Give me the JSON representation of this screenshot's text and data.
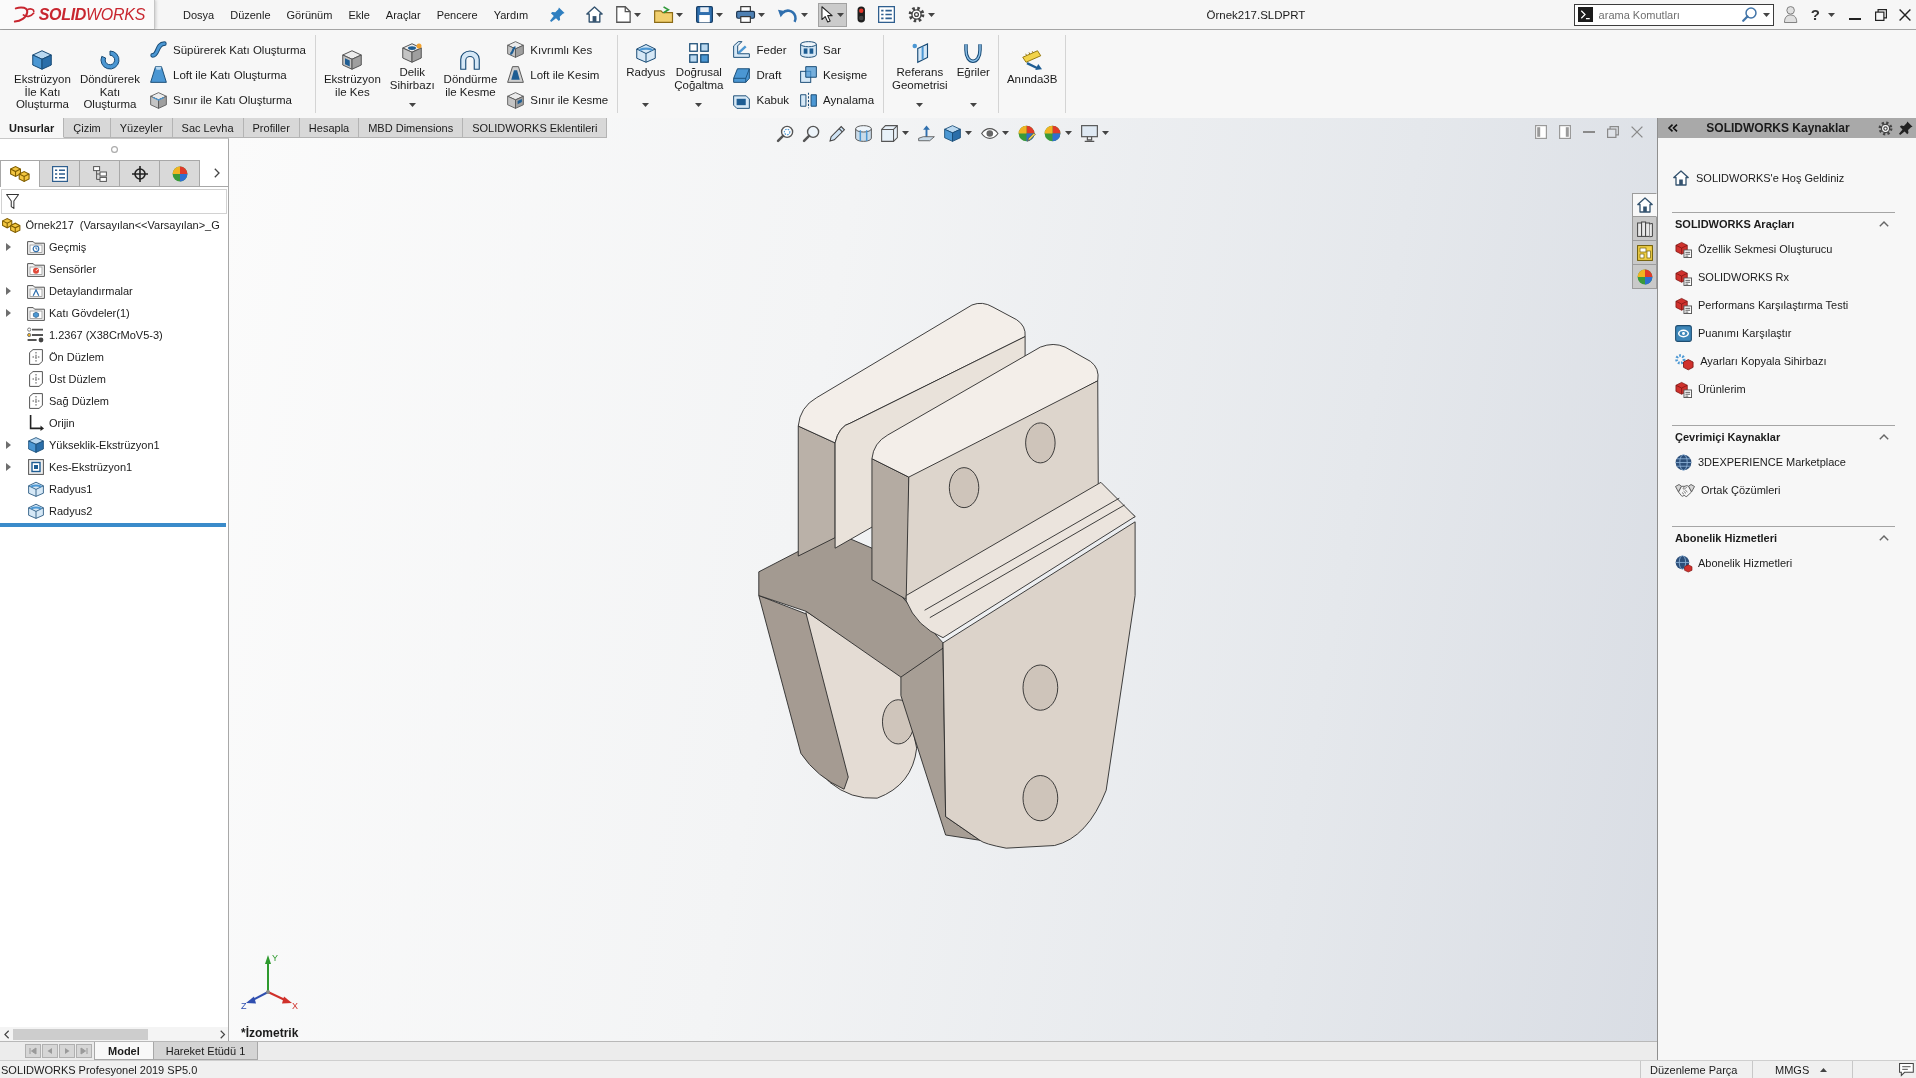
{
  "window": {
    "title": "Örnek217.SLDPRT",
    "help": "?"
  },
  "logo": {
    "text": "**SOLID**WORKS"
  },
  "menu": [
    "Dosya",
    "Düzenle",
    "Görünüm",
    "Ekle",
    "Araçlar",
    "Pencere",
    "Yardım"
  ],
  "quick_access": [
    {
      "dropdown": false,
      "selected": false
    },
    {
      "dropdown": true,
      "selected": false
    },
    {
      "dropdown": true,
      "selected": false
    },
    {
      "dropdown": true,
      "selected": false
    },
    {
      "dropdown": true,
      "selected": false
    },
    {
      "dropdown": true,
      "selected": false
    },
    {
      "dropdown": true,
      "selected": true
    },
    {
      "dropdown": false,
      "selected": false
    },
    {
      "dropdown": false,
      "selected": false
    },
    {
      "dropdown": true,
      "selected": false
    }
  ],
  "search": {
    "placeholder": "arama Komutları"
  },
  "ribbon": {
    "groups": [
      {
        "items": [
          {
            "kind": "large",
            "label": "Ekstrüzyon\nİle Katı\nOluşturma",
            "dropdown": false
          },
          {
            "kind": "large",
            "label": "Döndürerek\nKatı\nOluşturma",
            "dropdown": false
          },
          {
            "kind": "stack",
            "items": [
              "Süpürerek Katı Oluşturma",
              "Loft ile Katı Oluşturma",
              "Sınır ile Katı Oluşturma"
            ]
          }
        ]
      },
      {
        "items": [
          {
            "kind": "large",
            "label": "Ekstrüzyon\nile Kes",
            "dropdown": false
          },
          {
            "kind": "large",
            "label": "Delik\nSihirbazı",
            "dropdown": true
          },
          {
            "kind": "large",
            "label": "Döndürme\nile Kesme",
            "dropdown": false
          },
          {
            "kind": "stack",
            "items": [
              "Kıvrımlı Kes",
              "Loft ile Kesim",
              "Sınır ile Kesme"
            ]
          }
        ]
      },
      {
        "items": [
          {
            "kind": "large",
            "label": "Radyus",
            "dropdown": true
          },
          {
            "kind": "large",
            "label": "Doğrusal\nÇoğaltma",
            "dropdown": true
          },
          {
            "kind": "stack",
            "items": [
              "Feder",
              "Draft",
              "Kabuk"
            ]
          },
          {
            "kind": "stack",
            "items": [
              "Sar",
              "Kesişme",
              "Aynalama"
            ]
          }
        ]
      },
      {
        "items": [
          {
            "kind": "large",
            "label": "Referans\nGeometrisi",
            "dropdown": true
          },
          {
            "kind": "large",
            "label": "Eğriler",
            "dropdown": true
          }
        ]
      },
      {
        "items": [
          {
            "kind": "large",
            "label": "Anında3B",
            "dropdown": false
          }
        ]
      }
    ]
  },
  "command_tabs": [
    {
      "label": "Unsurlar",
      "selected": true
    },
    {
      "label": "Çizim",
      "selected": false
    },
    {
      "label": "Yüzeyler",
      "selected": false
    },
    {
      "label": "Sac Levha",
      "selected": false
    },
    {
      "label": "Profiller",
      "selected": false
    },
    {
      "label": "Hesapla",
      "selected": false
    },
    {
      "label": "MBD Dimensions",
      "selected": false
    },
    {
      "label": "SOLIDWORKS Eklentileri",
      "selected": false
    }
  ],
  "feature_manager": {
    "tabs": [
      {
        "selected": true
      },
      {
        "selected": false
      },
      {
        "selected": false
      },
      {
        "selected": false
      },
      {
        "selected": false
      }
    ],
    "tree": {
      "label": "Örnek217  (Varsayılan<<Varsayılan>_G",
      "children": [
        {
          "label": "Geçmiş",
          "kind": "history",
          "expandable": true
        },
        {
          "label": "Sensörler",
          "kind": "sensors",
          "expandable": false
        },
        {
          "label": "Detaylandırmalar",
          "kind": "annotations",
          "expandable": true
        },
        {
          "label": "Katı Gövdeler(1)",
          "kind": "bodies",
          "expandable": true
        },
        {
          "label": "1.2367 (X38CrMoV5-3)",
          "kind": "material",
          "expandable": false
        },
        {
          "label": "Ön Düzlem",
          "kind": "plane",
          "expandable": false
        },
        {
          "label": "Üst Düzlem",
          "kind": "plane",
          "expandable": false
        },
        {
          "label": "Sağ Düzlem",
          "kind": "plane",
          "expandable": false
        },
        {
          "label": "Orijin",
          "kind": "origin",
          "expandable": false
        },
        {
          "label": "Yükseklik-Ekstrüzyon1",
          "kind": "extrude",
          "expandable": true
        },
        {
          "label": "Kes-Ekstrüzyon1",
          "kind": "cut",
          "expandable": true
        },
        {
          "label": "Radyus1",
          "kind": "fillet",
          "expandable": false
        },
        {
          "label": "Radyus2",
          "kind": "fillet",
          "expandable": false
        }
      ]
    }
  },
  "graphics": {
    "view_toolbar": [
      {
        "dropdown": false
      },
      {
        "dropdown": false
      },
      {
        "dropdown": false
      },
      {
        "dropdown": false
      },
      {
        "dropdown": true
      },
      {
        "dropdown": false
      },
      {
        "dropdown": true
      },
      {
        "dropdown": true
      },
      {
        "dropdown": false
      },
      {
        "dropdown": true
      },
      {
        "dropdown": true
      }
    ],
    "task_tabs": [
      {
        "selected": true
      },
      {
        "selected": false
      },
      {
        "selected": false
      },
      {
        "selected": false
      }
    ],
    "triad_labels": [
      "Y",
      "Z",
      "X"
    ],
    "view_label": "*İzometrik"
  },
  "task_pane": {
    "title": "SOLIDWORKS Kaynaklar",
    "welcome": "SOLIDWORKS'e Hoş Geldiniz",
    "sections": [
      {
        "title": "SOLIDWORKS Araçları",
        "expanded": true,
        "items": [
          "Özellik Sekmesi Oluşturucu",
          "SOLIDWORKS Rx",
          "Performans Karşılaştırma Testi",
          "Puanımı Karşılaştır",
          "Ayarları Kopyala Sihirbazı",
          "Ürünlerim"
        ]
      },
      {
        "title": "Çevrimiçi Kaynaklar",
        "expanded": true,
        "items": [
          "3DEXPERIENCE Marketplace",
          "Ortak Çözümleri"
        ]
      },
      {
        "title": "Abonelik Hizmetleri",
        "expanded": true,
        "items": [
          "Abonelik Hizmetleri"
        ]
      }
    ]
  },
  "bottom_tabs": [
    {
      "label": "Model",
      "selected": true
    },
    {
      "label": "Hareket Etüdü 1",
      "selected": false
    }
  ],
  "status_bar": {
    "product": "SOLIDWORKS Profesyonel 2019 SP5.0",
    "mode": "Düzenleme Parça",
    "units": "MMGS"
  }
}
